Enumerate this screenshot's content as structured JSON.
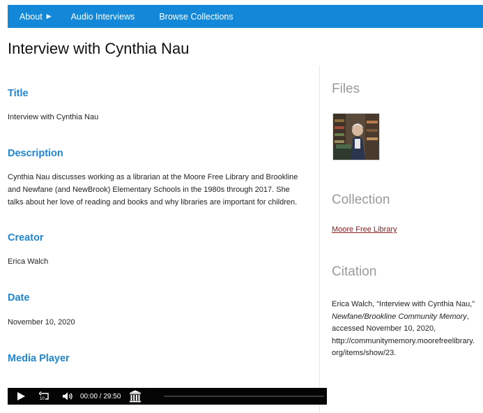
{
  "nav": {
    "about": "About",
    "audio_interviews": "Audio Interviews",
    "browse_collections": "Browse Collections"
  },
  "page_title": "Interview with Cynthia Nau",
  "fields": {
    "title": {
      "heading": "Title",
      "value": "Interview with Cynthia Nau"
    },
    "description": {
      "heading": "Description",
      "lines": [
        "Cynthia Nau discusses working as a librarian at the Moore Free Library and Brookline",
        "and Newfane (and NewBrook) Elementary Schools in the 1980s through 2017. She",
        "talks about her love of reading and books and why libraries are important for children."
      ]
    },
    "creator": {
      "heading": "Creator",
      "value": "Erica Walch"
    },
    "date": {
      "heading": "Date",
      "value": "November 10, 2020"
    },
    "media_player": {
      "heading": "Media Player"
    }
  },
  "sidebar": {
    "files_heading": "Files",
    "collection_heading": "Collection",
    "collection_link": "Moore Free Library",
    "citation_heading": "Citation",
    "citation": {
      "lead": "Erica Walch, “Interview with Cynthia Nau,”",
      "publication": "Newfane/Brookline Community Memory",
      "publication_suffix": ",",
      "accessed": "accessed November 10, 2020,",
      "url_line1": "http://communitymemory.moorefreelibrary.",
      "url_line2": "org/items/show/23."
    }
  },
  "player": {
    "skip_back_label": "10",
    "time": "00:00 / 29:50",
    "progress": 0
  },
  "colors": {
    "nav_bg": "#1488d8",
    "heading_blue": "#1f86cf",
    "side_heading_gray": "#9a9a9a",
    "link": "#8b1a1a",
    "player_bg": "#050505"
  },
  "icons": {
    "about_caret": "caret-right-icon",
    "play": "play-icon",
    "skip_back": "skip-back-10-icon",
    "volume": "volume-icon",
    "archive": "archive-icon"
  }
}
